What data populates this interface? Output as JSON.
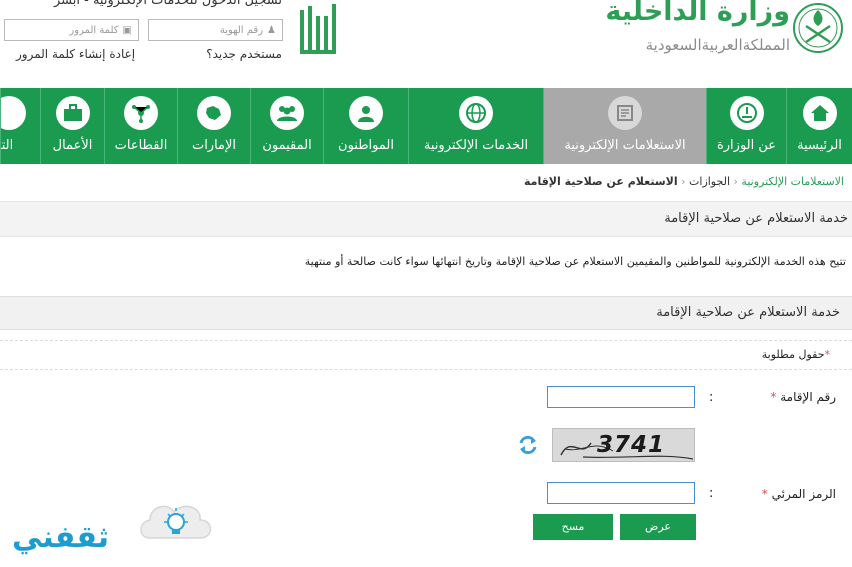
{
  "header": {
    "login_title": "تسجيل الدخول للخدمات الإلكترونية - أبشر",
    "id_placeholder": "رقم الهوية",
    "password_placeholder": "كلمة المرور",
    "new_user_link": "مستخدم جديد؟",
    "reset_password_link": "إعادة إنشاء كلمة المرور",
    "moi_title": "وزارة الداخلية",
    "moi_subtitle": "المملكةالعربيةالسعودية"
  },
  "nav": {
    "items": [
      {
        "label": "الرئيسية",
        "icon": "home-icon"
      },
      {
        "label": "عن الوزارة",
        "icon": "ministry-emblem-icon"
      },
      {
        "label": "الاستعلامات الإلكترونية",
        "icon": "inquiry-icon",
        "active": true
      },
      {
        "label": "الخدمات الإلكترونية",
        "icon": "globe-icon"
      },
      {
        "label": "المواطنون",
        "icon": "citizen-icon"
      },
      {
        "label": "المقيمون",
        "icon": "residents-icon"
      },
      {
        "label": "الإمارات",
        "icon": "emirates-icon"
      },
      {
        "label": "القطاعات",
        "icon": "sectors-icon"
      },
      {
        "label": "الأعمال",
        "icon": "briefcase-icon"
      },
      {
        "label": "التو",
        "icon": "partial-icon"
      }
    ]
  },
  "breadcrumb": {
    "items": [
      "الاستعلامات الإلكترونية",
      "الجوازات",
      "الاستعلام عن صلاحية الإقامة"
    ],
    "separator": "‹"
  },
  "page": {
    "title": "خدمة الاستعلام عن صلاحية الإقامة",
    "description": "تتيح هذه الخدمة الإلكترونية للمواطنين والمقيمين الاستعلام عن صلاحية الإقامة وتاريخ انتهائها سواء كانت صالحة أو منتهية"
  },
  "form": {
    "title": "خدمة الاستعلام عن صلاحية الإقامة",
    "required_note": "حقول مطلوبة",
    "required_star": "*",
    "iqama_label": "رقم الإقامة",
    "captcha_label": "الرمز المرئي",
    "colon": ":",
    "captcha_text": "3741",
    "show_button": "عرض",
    "clear_button": "مسح"
  },
  "watermark": {
    "text": "ثقفني"
  },
  "colors": {
    "brand_green": "#1a9b50",
    "active_tab": "#aaa9a9",
    "required_red": "#d9534f"
  }
}
